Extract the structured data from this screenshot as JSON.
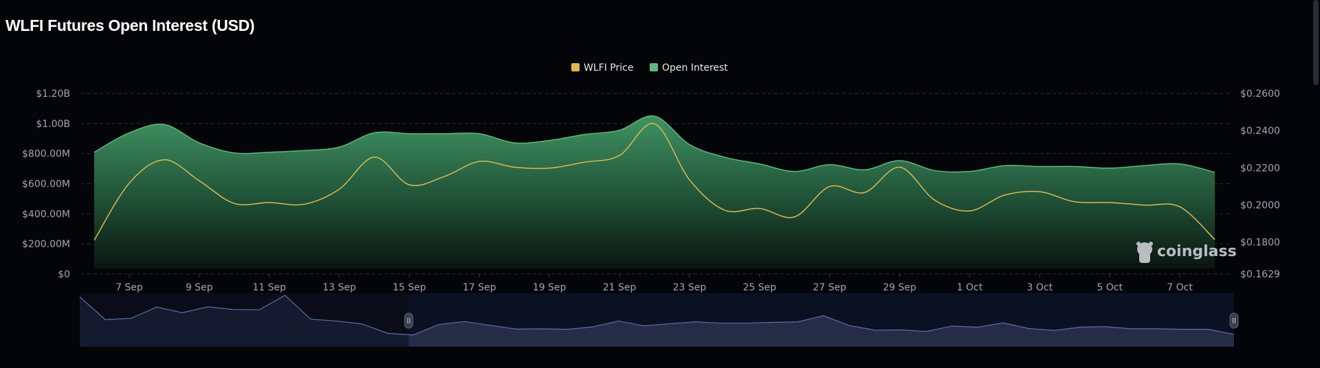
{
  "title": "WLFI Futures Open Interest (USD)",
  "watermark": "coinglass",
  "chart_data": {
    "type": "area+line",
    "title": "WLFI Futures Open Interest (USD)",
    "legend": {
      "placement": "top-center",
      "entries": [
        "WLFI Price",
        "Open Interest"
      ]
    },
    "colors": {
      "price": "#e0b84f",
      "open_interest": "#5fb97d",
      "grid": "#2b2d33",
      "navigator_line": "#5a6fa8",
      "navigator_fill": "#262c48"
    },
    "x": [
      "6 Sep",
      "7 Sep",
      "8 Sep",
      "9 Sep",
      "10 Sep",
      "11 Sep",
      "12 Sep",
      "13 Sep",
      "14 Sep",
      "15 Sep",
      "16 Sep",
      "17 Sep",
      "18 Sep",
      "19 Sep",
      "20 Sep",
      "21 Sep",
      "22 Sep",
      "23 Sep",
      "24 Sep",
      "25 Sep",
      "26 Sep",
      "27 Sep",
      "28 Sep",
      "29 Sep",
      "30 Sep",
      "1 Oct",
      "2 Oct",
      "3 Oct",
      "4 Oct",
      "5 Oct",
      "6 Oct",
      "7 Oct",
      "8 Oct"
    ],
    "x_ticks": [
      "7 Sep",
      "9 Sep",
      "11 Sep",
      "13 Sep",
      "15 Sep",
      "17 Sep",
      "19 Sep",
      "21 Sep",
      "23 Sep",
      "25 Sep",
      "27 Sep",
      "29 Sep",
      "1 Oct",
      "3 Oct",
      "5 Oct",
      "7 Oct"
    ],
    "series": [
      {
        "name": "Open Interest",
        "axis": "left",
        "type": "area",
        "values": [
          809,
          938,
          993,
          871,
          804,
          809,
          820,
          843,
          938,
          932,
          932,
          932,
          871,
          887,
          927,
          955,
          1049,
          860,
          776,
          731,
          681,
          726,
          692,
          753,
          687,
          681,
          720,
          714,
          714,
          703,
          720,
          731,
          675
        ]
      },
      {
        "name": "WLFI Price",
        "axis": "right",
        "type": "line",
        "values": [
          0.181,
          0.2117,
          0.2243,
          0.213,
          0.2008,
          0.2013,
          0.2004,
          0.2085,
          0.2257,
          0.2108,
          0.2153,
          0.2234,
          0.2203,
          0.2198,
          0.223,
          0.2266,
          0.2437,
          0.2135,
          0.1972,
          0.1981,
          0.1936,
          0.2099,
          0.2067,
          0.2203,
          0.2026,
          0.1968,
          0.2053,
          0.2071,
          0.2017,
          0.2013,
          0.1999,
          0.199,
          0.1814
        ]
      }
    ],
    "left_axis": {
      "unit": "USD millions",
      "ylim": [
        0,
        1200
      ],
      "tick_values": [
        0,
        200,
        400,
        600,
        800,
        1000,
        1200
      ],
      "tick_labels": [
        "$0",
        "$200.00M",
        "$400.00M",
        "$600.00M",
        "$800.00M",
        "$1.00B",
        "$1.20B"
      ]
    },
    "right_axis": {
      "ylim": [
        0.1629,
        0.26
      ],
      "tick_values": [
        0.1629,
        0.18,
        0.2,
        0.22,
        0.24,
        0.26
      ],
      "tick_labels": [
        "$0.1629",
        "$0.1800",
        "$0.2000",
        "$0.2200",
        "$0.2400",
        "$0.2600"
      ]
    },
    "grid": true,
    "navigator": {
      "selection": [
        0.285,
        1.0
      ],
      "relative_values": [
        186,
        101,
        106,
        148,
        127,
        149,
        139,
        138,
        192,
        103,
        96,
        85,
        50,
        44,
        83,
        94,
        80,
        66,
        67,
        65,
        74,
        96,
        78,
        86,
        93,
        88,
        88,
        91,
        93,
        116,
        79,
        62,
        63,
        57,
        77,
        73,
        89,
        68,
        61,
        73,
        75,
        67,
        67,
        65,
        65,
        46
      ]
    }
  }
}
